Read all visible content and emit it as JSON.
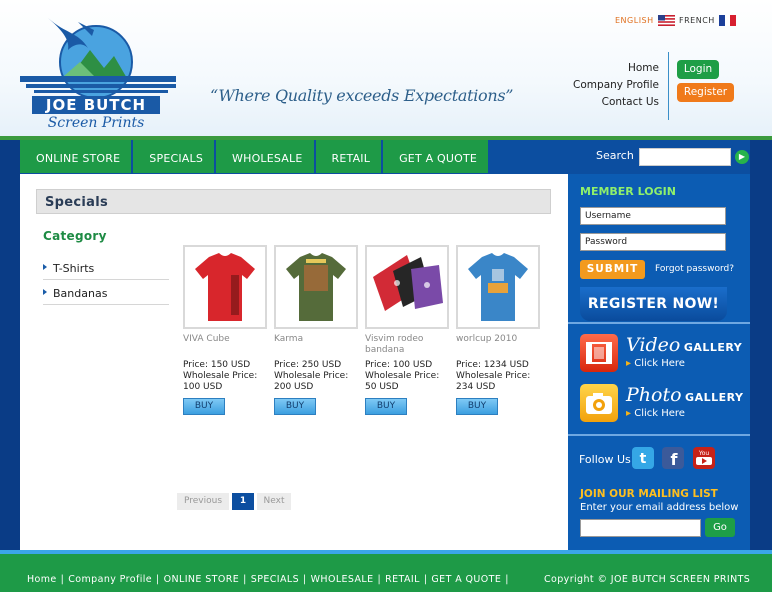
{
  "header": {
    "logo_text": "JOE BUTCH",
    "logo_sub": "Screen Prints",
    "tagline": "“Where Quality exceeds Expectations”",
    "languages": [
      {
        "label": "ENGLISH",
        "flag": "us-flag-icon"
      },
      {
        "label": "FRENCH",
        "flag": "fr-flag-icon"
      }
    ],
    "links": [
      "Home",
      "Company Profile",
      "Contact Us"
    ],
    "login_label": "Login",
    "register_label": "Register"
  },
  "nav": {
    "items": [
      "ONLINE STORE",
      "SPECIALS",
      "WHOLESALE",
      "RETAIL",
      "GET A QUOTE"
    ],
    "search_label": "Search",
    "search_value": ""
  },
  "main": {
    "title": "Specials",
    "category_title": "Category",
    "categories": [
      "T-Shirts",
      "Bandanas"
    ],
    "products": [
      {
        "name": "VIVA Cube",
        "price": "Price: 150 USD",
        "wholesale": "Wholesale Price: 100 USD",
        "buy_label": "BUY"
      },
      {
        "name": "Karma",
        "price": "Price: 250 USD",
        "wholesale": "Wholesale Price: 200 USD",
        "buy_label": "BUY"
      },
      {
        "name": "Visvim rodeo bandana",
        "price": "Price: 100 USD",
        "wholesale": "Wholesale Price: 50 USD",
        "buy_label": "BUY"
      },
      {
        "name": "worlcup 2010",
        "price": "Price: 1234 USD",
        "wholesale": "Wholesale Price: 234 USD",
        "buy_label": "BUY"
      }
    ],
    "pager": {
      "previous": "Previous",
      "current": "1",
      "next": "Next"
    }
  },
  "sidebar": {
    "member_login_title": "MEMBER LOGIN",
    "username_placeholder": "Username",
    "password_placeholder": "Password",
    "submit_label": "SUBMIT",
    "forgot_label": "Forgot password?",
    "register_now_label": "REGISTER NOW!",
    "video_gallery": {
      "big": "Video",
      "small": "GALLERY",
      "click": "Click Here"
    },
    "photo_gallery": {
      "big": "Photo",
      "small": "GALLERY",
      "click": "Click Here"
    },
    "follow_label": "Follow Us",
    "social": [
      "twitter-icon",
      "facebook-icon",
      "youtube-icon"
    ],
    "mailing_title": "JOIN OUR MAILING LIST",
    "mailing_sub": "Enter your email address below",
    "mailing_go": "Go"
  },
  "footer": {
    "links": [
      "Home",
      "Company Profile",
      "ONLINE STORE",
      "SPECIALS",
      "WHOLESALE",
      "RETAIL",
      "GET A QUOTE"
    ],
    "copyright": "Copyright © JOE BUTCH SCREEN PRINTS"
  },
  "colors": {
    "nav_green": "#1e9a47",
    "brand_blue": "#0c4ea0",
    "sidebar_blue": "#0c5cb3",
    "accent_orange": "#f07a1a"
  }
}
